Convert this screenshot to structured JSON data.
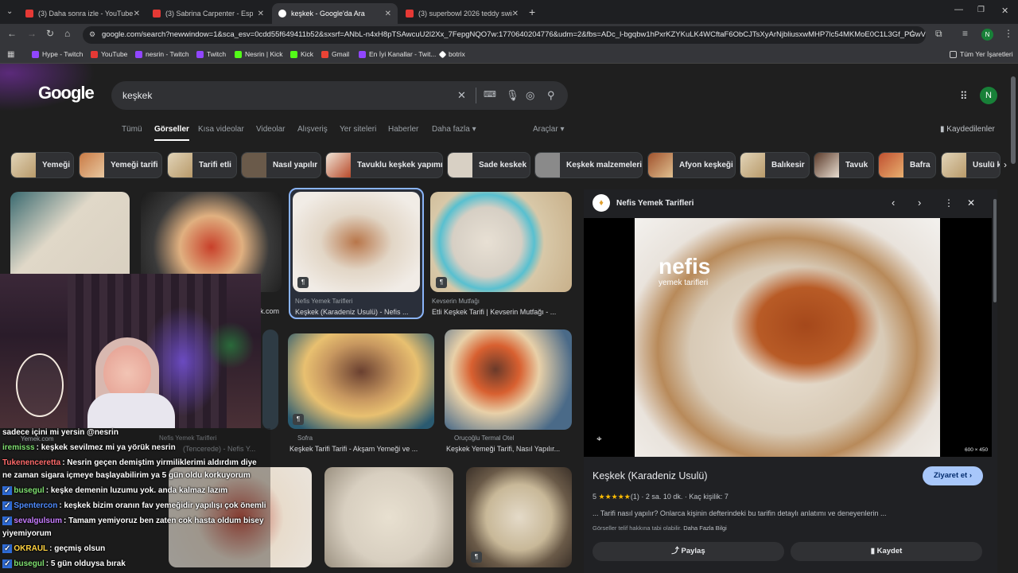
{
  "tabs": [
    {
      "label": "(3) Daha sonra izle - YouTube"
    },
    {
      "label": "(3) Sabrina Carpenter - Espresso"
    },
    {
      "label": "keşkek - Google'da Ara"
    },
    {
      "label": "(3) superbowl 2026 teddy swim"
    }
  ],
  "address": "google.com/search?newwindow=1&sca_esv=0cdd55f649411b52&sxsrf=ANbL-n4xH8pTSAwcuU2l2Xx_7FepgNQO7w:1770640204776&udm=2&fbs=ADc_l-bgqbw1hPxrKZYKuLK4WCftaF6ObCJTsXyArNjbliusxwMHP7lc54MKMoE0C1L3Gf_PGwVu...",
  "bookmarks": [
    "Hype - Twitch",
    "YouTube",
    "nesrin - Twitch",
    "Twitch",
    "Nesrin | Kick",
    "Kick",
    "Gmail",
    "En İyi Kanallar - Twit...",
    "botrix",
    "Tüm Yer İşaretleri"
  ],
  "avatar_letter": "N",
  "search_query": "keşkek",
  "nav": [
    "Tümü",
    "Görseller",
    "Kısa videolar",
    "Videolar",
    "Alışveriş",
    "Yer siteleri",
    "Haberler",
    "Daha fazla",
    "Araçlar"
  ],
  "saved": "Kaydedilenler",
  "chips": [
    "Yemeği",
    "Yemeği tarifi",
    "Tarifi etli",
    "Nasıl yapılır",
    "Tavuklu keşkek yapımı",
    "Sade keskek",
    "Keşkek malzemeleri",
    "Afyon keşkeği",
    "Balıkesir",
    "Tavuk",
    "Bafra",
    "Usulü k"
  ],
  "results": [
    {
      "source": "Nefis Yemek Tarifleri",
      "caption": "Keşkek (Karadeniz Usulü) - Nefis ..."
    },
    {
      "source": "Kevserin Mutfağı",
      "caption": "Etli Keşkek Tarifi | Kevserin Mutfağı - ..."
    },
    {
      "source": "Sofra",
      "caption": "Keşkek Tarifi Tarifi - Akşam Yemeği ve ..."
    },
    {
      "source": "Oruçoğlu Termal Otel",
      "caption": "Keşkek Yemeği Tarifi, Nasıl Yapılır..."
    },
    {
      "source": "Nefis Yemek Tarifleri",
      "caption": "(Tencerede) - Nefis Y..."
    },
    {
      "source": "Yemek.com",
      "caption": ""
    },
    {
      "source": "",
      "caption": "k.com"
    }
  ],
  "detail": {
    "site": "Nefis Yemek Tarifleri",
    "title": "Keşkek (Karadeniz Usulü)",
    "visit": "Ziyaret et",
    "rating": "5",
    "stars": "★★★★★",
    "reviews": "(1)",
    "time": "2 sa. 10 dk.",
    "servings": "Kaç kişilik: 7",
    "description": "... Tarifi nasıl yapılır? Onlarca kişinin defterindeki bu tarifin detaylı anlatımı ve deneyenlerin ...",
    "copyright": "Görseller telif hakkına tabi olabilir.",
    "learn_more": "Daha Fazla Bilgi",
    "share": "Paylaş",
    "save": "Kaydet",
    "size": "600 × 450",
    "watermark": "nefis",
    "watermark_sub": "yemek tarifleri"
  },
  "chat": [
    {
      "user": "",
      "text": "sadece içini mi yersin @nesrin",
      "color": "#ffffff"
    },
    {
      "user": "iremisss",
      "text": ": keşkek sevilmez mi ya yörük nesrin",
      "color": "#7fe070"
    },
    {
      "user": "Tukenenceretta",
      "text": ": Nesrin geçen demiştim yirmiliklerimi aldırdım diye",
      "color": "#ff6b6b"
    },
    {
      "user": "",
      "text": "ne zaman sigara içmeye başlayabilirim ya 5 gün oldu korkuyorum",
      "color": "#ffffff"
    },
    {
      "user": "busegul",
      "text": ": keşke demenin luzumu yok. anda kalmaz lazım",
      "color": "#7fe070"
    },
    {
      "user": "Spentercon",
      "text": ": keşkek bizim oranın fav yemeğidir yapılışı çok önemli",
      "color": "#4f8cff"
    },
    {
      "user": "sevalgulsum",
      "text": ": Tamam yemiyoruz ben zaten cok hasta oldum bisey",
      "color": "#c77dff"
    },
    {
      "user": "",
      "text": "yiyemiyorum",
      "color": "#ffffff"
    },
    {
      "user": "OKRAUL",
      "text": ": geçmiş olsun",
      "color": "#ffd23f"
    },
    {
      "user": "busegul",
      "text": ": 5 gün olduysa bırak",
      "color": "#7fe070"
    }
  ]
}
